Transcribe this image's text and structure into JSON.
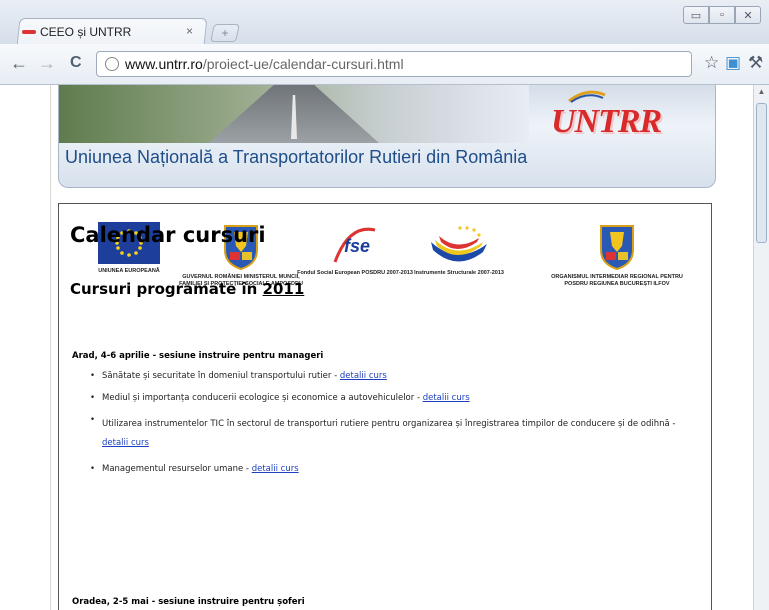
{
  "browser": {
    "tab_title": "CEEO și UNTRR",
    "url_host": "www.untrr.ro",
    "url_path": "/proiect-ue/calendar-cursuri.html",
    "tab_close": "×",
    "new_tab": "+",
    "window_buttons": [
      "▭",
      "▫",
      "✕"
    ],
    "nav": {
      "back": "←",
      "forward": "→",
      "reload": "C"
    },
    "toolbar_icons": {
      "star": "☆",
      "extension": "▣",
      "wrench": "⚒"
    }
  },
  "banner": {
    "title": "Uniunea Națională a Transportatorilor Rutieri din România",
    "logo_text": "UNTRR"
  },
  "logos": [
    {
      "caption": "UNIUNEA EUROPEANĂ"
    },
    {
      "caption": "GUVERNUL ROMÂNIEI MINISTERUL MUNCII, FAMILIEI ȘI PROTECȚIEI SOCIALE AMPOSDRU"
    },
    {
      "caption": "Fondul Social European POSDRU 2007-2013",
      "mark": "fse"
    },
    {
      "caption": "Instrumente Structurale 2007-2013"
    },
    {
      "caption": "ORGANISMUL INTERMEDIAR REGIONAL PENTRU POSDRU REGIUNEA BUCUREȘTI ILFOV"
    }
  ],
  "page": {
    "heading": "Calendar cursuri",
    "subheading_prefix": "Cursuri programate în",
    "subheading_year": "2011",
    "sessions": [
      {
        "title": "Arad, 4-6 aprilie - sesiune instruire pentru manageri",
        "items": [
          {
            "text": "Sănătate și securitate în domeniul transportului rutier -",
            "link": "detalii curs"
          },
          {
            "text": "Mediul și importanța conducerii ecologice și economice a autovehiculelor -",
            "link": "detalii curs"
          },
          {
            "text": "Utilizarea instrumentelor TIC în sectorul de transporturi rutiere pentru organizarea și înregistrarea timpilor de conducere și de odihnă -",
            "link": "detalii curs"
          },
          {
            "text": "Managementul resurselor umane -",
            "link": "detalii curs"
          }
        ]
      },
      {
        "title": "Oradea, 2-5 mai - sesiune instruire pentru șoferi",
        "items": []
      }
    ]
  }
}
